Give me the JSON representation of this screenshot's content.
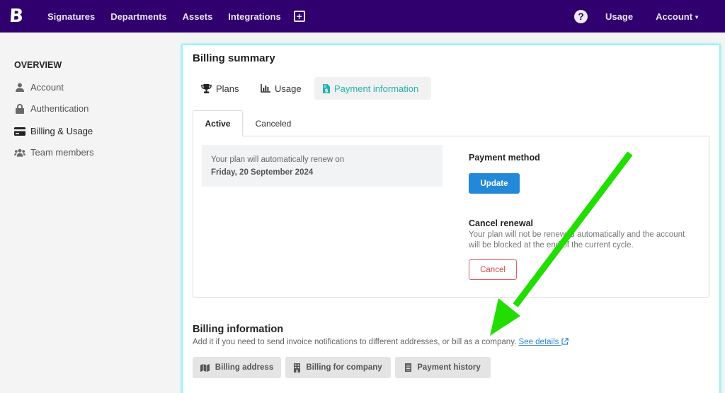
{
  "topbar": {
    "logo": "B",
    "nav": [
      "Signatures",
      "Departments",
      "Assets",
      "Integrations"
    ],
    "add_icon": "plus-square-icon",
    "help_icon": "question-circle-icon",
    "usage": "Usage",
    "account": "Account",
    "account_caret": "▼"
  },
  "sidebar": {
    "heading": "OVERVIEW",
    "items": [
      {
        "label": "Account",
        "icon": "user-icon"
      },
      {
        "label": "Authentication",
        "icon": "lock-icon"
      },
      {
        "label": "Billing & Usage",
        "icon": "credit-card-icon",
        "active": true
      },
      {
        "label": "Team members",
        "icon": "users-icon"
      }
    ]
  },
  "billing_summary": {
    "title": "Billing summary",
    "tabs": [
      {
        "label": "Plans",
        "icon": "trophy-icon"
      },
      {
        "label": "Usage",
        "icon": "chart-bar-icon"
      },
      {
        "label": "Payment information",
        "icon": "invoice-dollar-icon",
        "selected": true
      }
    ],
    "subtabs": [
      {
        "label": "Active",
        "active": true
      },
      {
        "label": "Canceled"
      }
    ],
    "renew_text": "Your plan will automatically renew on",
    "renew_date": "Friday, 20 September 2024",
    "payment_method_title": "Payment method",
    "update_label": "Update",
    "cancel_renewal_title": "Cancel renewal",
    "cancel_renewal_text": "Your plan will not be renewed automatically and the account will be blocked at the end of the current cycle.",
    "cancel_label": "Cancel"
  },
  "billing_information": {
    "title": "Billing information",
    "text": "Add it if you need to send invoice notifications to different addresses, or bill as a company.",
    "link": "See details",
    "buttons": [
      {
        "label": "Billing address",
        "icon": "map-icon"
      },
      {
        "label": "Billing for company",
        "icon": "building-icon"
      },
      {
        "label": "Payment history",
        "icon": "receipt-icon"
      }
    ]
  },
  "colors": {
    "topbar": "#2f006e",
    "accent_teal": "#22b3ae",
    "primary_blue": "#2288d7",
    "danger_red": "#d84848",
    "annotation_arrow": "#22dd00"
  }
}
